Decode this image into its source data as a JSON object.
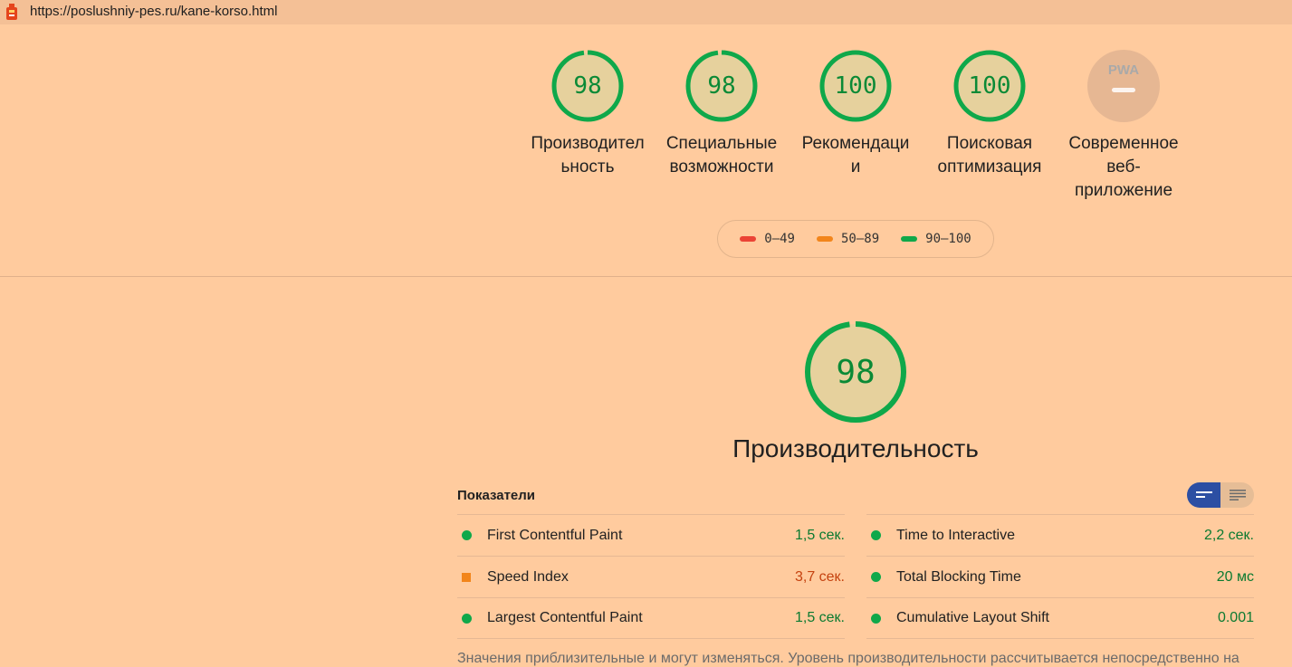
{
  "url_bar": {
    "url": "https://poslushniy-pes.ru/kane-korso.html"
  },
  "gauges": [
    {
      "score": "98",
      "label_line1": "Производител",
      "label_line2": "ьность",
      "label_line3": ""
    },
    {
      "score": "98",
      "label_line1": "Специальные",
      "label_line2": "возможности",
      "label_line3": ""
    },
    {
      "score": "100",
      "label_line1": "Рекомендаци",
      "label_line2": "и",
      "label_line3": ""
    },
    {
      "score": "100",
      "label_line1": "Поисковая",
      "label_line2": "оптимизация",
      "label_line3": ""
    }
  ],
  "pwa": {
    "icon_text": "PWA",
    "label_line1": "Современное",
    "label_line2": "веб-",
    "label_line3": "приложение"
  },
  "legend": [
    {
      "range": "0–49",
      "color": "#eb4335"
    },
    {
      "range": "50–89",
      "color": "#f2851b"
    },
    {
      "range": "90–100",
      "color": "#0fa84a"
    }
  ],
  "category": {
    "score": "98",
    "score_fraction": 0.98,
    "title": "Производительность"
  },
  "metrics": {
    "title": "Показатели",
    "left": [
      {
        "name": "First Contentful Paint",
        "value": "1,5 сек.",
        "status": "pass"
      },
      {
        "name": "Speed Index",
        "value": "3,7 сек.",
        "status": "average"
      },
      {
        "name": "Largest Contentful Paint",
        "value": "1,5 сек.",
        "status": "pass"
      }
    ],
    "right": [
      {
        "name": "Time to Interactive",
        "value": "2,2 сек.",
        "status": "pass"
      },
      {
        "name": "Total Blocking Time",
        "value": "20 мс",
        "status": "pass"
      },
      {
        "name": "Cumulative Layout Shift",
        "value": "0.001",
        "status": "pass"
      }
    ]
  },
  "footnote": "Значения приблизительные и могут изменяться. Уровень производительности рассчитывается непосредственно на"
}
